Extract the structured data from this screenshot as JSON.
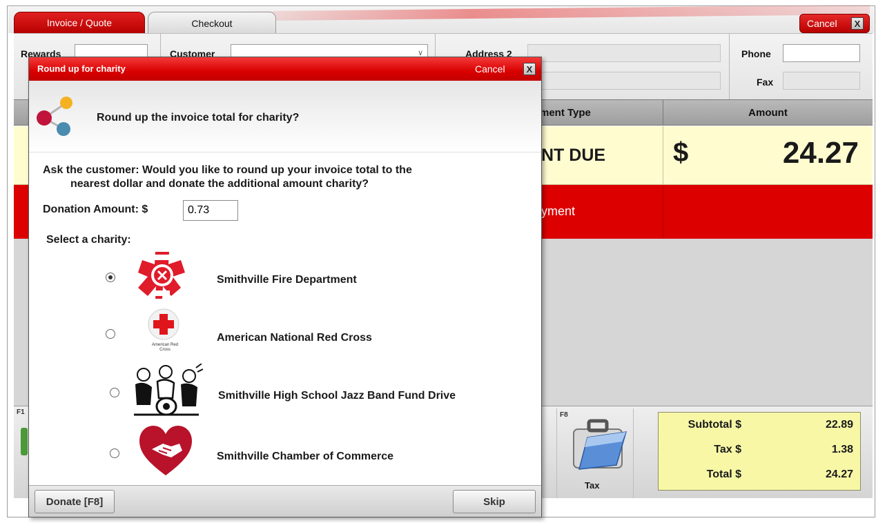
{
  "tabs": [
    {
      "label": "Invoice / Quote",
      "active": false
    },
    {
      "label": "Checkout",
      "active": true
    }
  ],
  "window": {
    "cancel_label": "Cancel",
    "close_glyph": "X"
  },
  "header": {
    "rewards_label": "Rewards",
    "customer_label": "Customer",
    "address2_label": "Address 2",
    "phone_label": "Phone",
    "fax_label": "Fax"
  },
  "grid": {
    "payment_type_header": "ment Type",
    "amount_header": "Amount",
    "due_label": "NT DUE",
    "due_currency": "$",
    "due_amount": "24.27",
    "payment_row_label": "yment"
  },
  "toolbar": {
    "f_key_left": "F1",
    "f8_label": "F8",
    "tax_button_label": "Tax"
  },
  "totals": {
    "subtotal_label": "Subtotal $",
    "subtotal_value": "22.89",
    "tax_label": "Tax $",
    "tax_value": "1.38",
    "total_label": "Total $",
    "total_value": "24.27"
  },
  "modal": {
    "title": "Round up for charity",
    "cancel_label": "Cancel",
    "close_glyph": "X",
    "question": "Round up the invoice total for charity?",
    "ask_line1": "Ask the customer: Would you like to round up your invoice total to the",
    "ask_line2": "nearest dollar and donate the additional amount charity?",
    "donation_label": "Donation Amount: $",
    "donation_value": "0.73",
    "select_label": "Select a charity:",
    "charities": [
      {
        "name": "Smithville Fire Department",
        "selected": true,
        "logo": "fire-department-emblem"
      },
      {
        "name": "American National Red Cross",
        "selected": false,
        "logo": "red-cross-logo",
        "logo_text": "American Red Cross"
      },
      {
        "name": "Smithville High School Jazz Band Fund Drive",
        "selected": false,
        "logo": "jazz-band-illustration"
      },
      {
        "name": "Smithville Chamber of Commerce",
        "selected": false,
        "logo": "heart-handshake-logo"
      }
    ],
    "donate_button": "Donate [F8]",
    "skip_button": "Skip"
  },
  "colors": {
    "brand_red": "#d90000",
    "due_bg": "#fffdd0",
    "totals_bg": "#f7f7a6"
  }
}
